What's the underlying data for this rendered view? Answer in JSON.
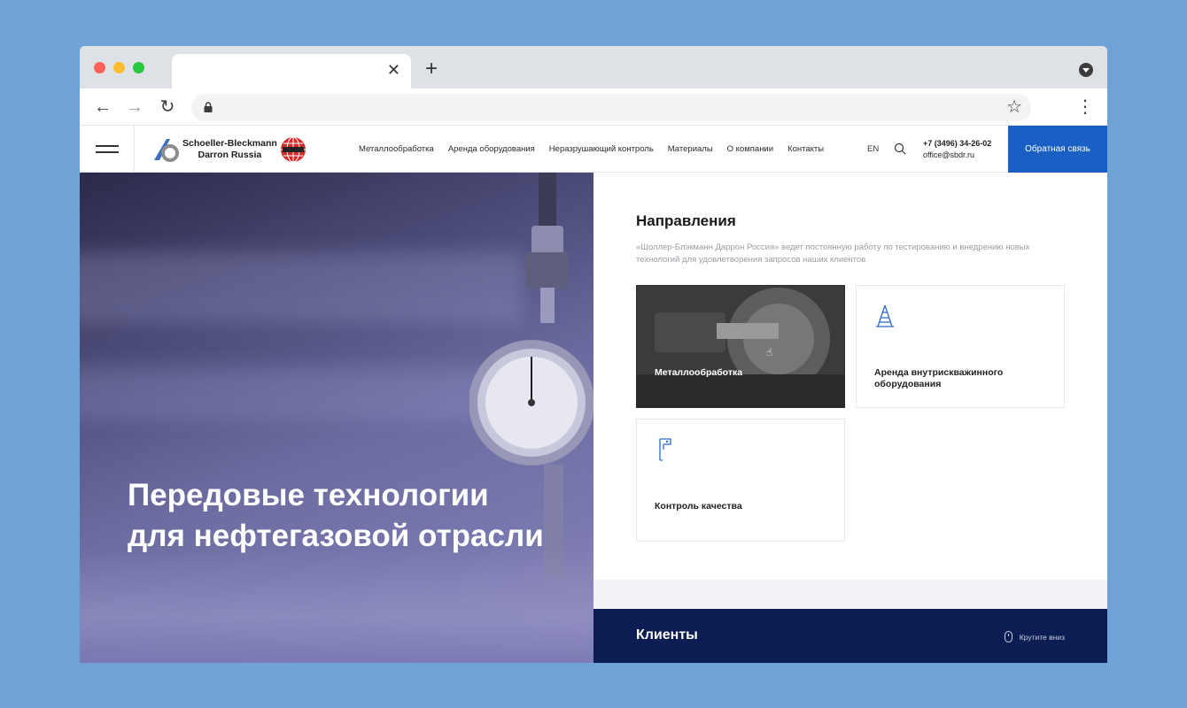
{
  "browser": {
    "tab_close_glyph": "✕",
    "new_tab_glyph": "+",
    "back_glyph": "←",
    "forward_glyph": "→",
    "reload_glyph": "↻",
    "star_glyph": "☆",
    "menu_glyph": "⋮",
    "address": ""
  },
  "header": {
    "logo_line1": "Schoeller-Bleckmann",
    "logo_line2": "Darron Russia",
    "nav": [
      "Металлообработка",
      "Аренда оборудования",
      "Неразрушающий контроль",
      "Материалы",
      "О компании",
      "Контакты"
    ],
    "lang": "EN",
    "phone": "+7 (3496) 34-26-02",
    "email": "office@sbdr.ru",
    "feedback_label": "Обратная связь",
    "accent_color": "#1a5fc4"
  },
  "hero": {
    "title": "Передовые технологии для нефтегазовой отрасли"
  },
  "directions": {
    "title": "Направления",
    "description": "«Шоллер-Блэкманн Даррон Россия» ведет постоянную работу по тестированию и внедрению новых технологий для удовлетворения запросов наших клиентов",
    "cards": [
      {
        "label": "Металлообработка",
        "icon": "lathe-photo"
      },
      {
        "label": "Аренда внутрискважинного оборудования",
        "icon": "derrick-icon"
      },
      {
        "label": "Контроль качества",
        "icon": "caliper-icon"
      }
    ]
  },
  "clients": {
    "title": "Клиенты",
    "scroll_hint": "Крутите вниз",
    "bg_color": "#0b1d52"
  }
}
